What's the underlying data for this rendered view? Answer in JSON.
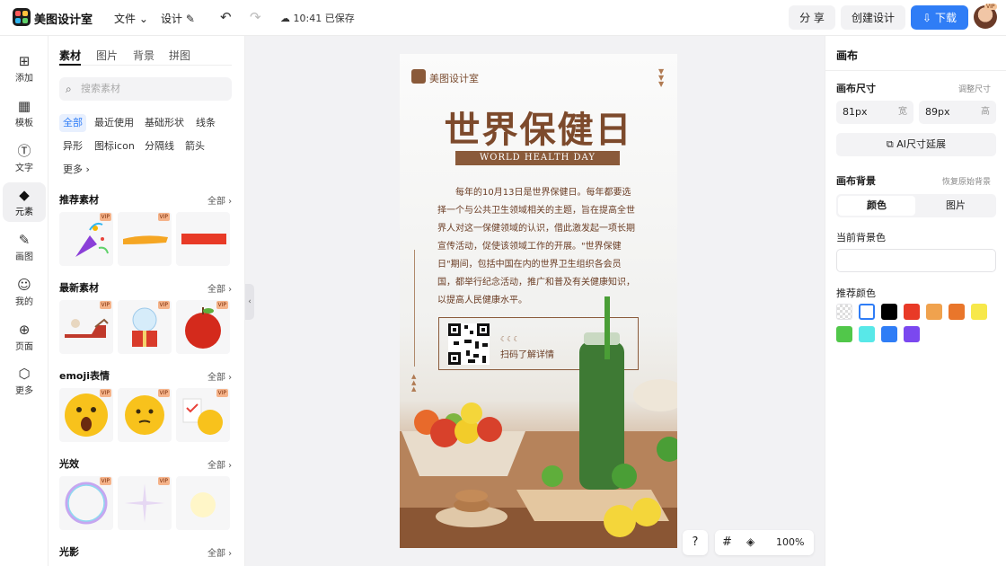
{
  "app": {
    "name": "美图设计室"
  },
  "toolbar": {
    "file": "文件",
    "design": "设计",
    "save_status": "10:41 已保存",
    "share": "分 享",
    "create": "创建设计",
    "download": "下载",
    "avatar_badge": "VIP"
  },
  "rail": [
    {
      "label": "添加",
      "icon": "plus-square-icon"
    },
    {
      "label": "模板",
      "icon": "template-icon"
    },
    {
      "label": "文字",
      "icon": "text-icon"
    },
    {
      "label": "元素",
      "icon": "shapes-icon"
    },
    {
      "label": "画图",
      "icon": "draw-icon"
    },
    {
      "label": "我的",
      "icon": "user-icon"
    },
    {
      "label": "页面",
      "icon": "page-icon"
    },
    {
      "label": "更多",
      "icon": "more-icon"
    }
  ],
  "panel": {
    "tabs": [
      "素材",
      "图片",
      "背景",
      "拼图"
    ],
    "search_placeholder": "搜索素材",
    "chips": [
      "全部",
      "最近使用",
      "基础形状",
      "线条",
      "异形",
      "图标icon",
      "分隔线",
      "箭头",
      "更多"
    ],
    "sections": [
      {
        "title": "推荐素材",
        "all": "全部"
      },
      {
        "title": "最新素材",
        "all": "全部"
      },
      {
        "title": "emoji表情",
        "all": "全部"
      },
      {
        "title": "光效",
        "all": "全部"
      },
      {
        "title": "光影",
        "all": "全部"
      }
    ],
    "vip": "VIP"
  },
  "poster": {
    "brand": "美图设计室",
    "title": "世界保健日",
    "subtitle": "WORLD HEALTH DAY",
    "body": "每年的10月13日是世界保健日。每年都要选择一个与公共卫生领域相关的主题，旨在提高全世界人对这一保健领域的认识，借此激发起一项长期宣传活动，促使该领域工作的开展。\"世界保健日\"期间，包括中国在内的世界卫生组织各会员国，都举行纪念活动，推广和普及有关健康知识，以提高人民健康水平。",
    "qr_text": "扫码了解详情",
    "qr_moon": "☾☾☾"
  },
  "zoom": {
    "level": "100%"
  },
  "props": {
    "heading": "画布",
    "size_label": "画布尺寸",
    "size_link": "调整尺寸",
    "width_value": "81px",
    "width_unit": "宽",
    "height_value": "89px",
    "height_unit": "高",
    "ai_extend": "AI尺寸延展",
    "bg_label": "画布背景",
    "bg_reset": "恢复原始背景",
    "seg_color": "颜色",
    "seg_image": "图片",
    "current_bg": "当前背景色",
    "recommended": "推荐颜色",
    "colors": [
      "transparent",
      "#ffffff",
      "#000000",
      "#e83a27",
      "#f0a24e",
      "#e9762b",
      "#f7e84a",
      "#51c74a",
      "#58e8e8",
      "#2f7df6",
      "#7b48ef"
    ]
  }
}
